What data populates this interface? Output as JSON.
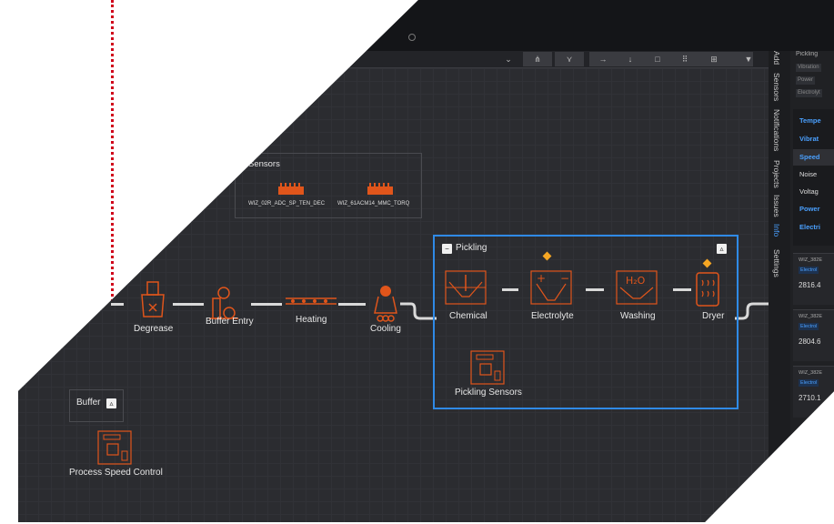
{
  "colors": {
    "accent": "#2f8ae6",
    "icon": "#e0551b",
    "warning": "#f5a623",
    "annotation": "#d0021b"
  },
  "toolbar": {
    "buttons": [
      "chevron-down-icon",
      "hierarchy-icon",
      "branch-icon",
      "arrow-right-icon",
      "arrow-down-icon",
      "frame-icon",
      "dots-icon",
      "grid-icon",
      "filter-icon"
    ]
  },
  "side_tabs": [
    "Add",
    "Sensors",
    "Notifications",
    "Projects",
    "Issues",
    "Info",
    "Settings"
  ],
  "side_tabs_active": "Info",
  "right_panel": {
    "title": "Pickling",
    "chips": [
      "Vibration",
      "Power",
      "Electrolyt"
    ],
    "metrics": [
      "Tempe",
      "Vibrat",
      "Speed",
      "Noise",
      "Voltag",
      "Power",
      "Electri"
    ],
    "cards": [
      {
        "id": "WIZ_382E",
        "tag": "Electrol",
        "value": "2816.4"
      },
      {
        "id": "WIZ_382E",
        "tag": "Electrol",
        "value": "2804.6"
      },
      {
        "id": "WIZ_382E",
        "tag": "Electrol",
        "value": "2710.1"
      }
    ]
  },
  "sensors_group": {
    "title": "Sensors",
    "items": [
      "WIZ_02R_ADC_SP_TEN_DEC",
      "WIZ_61ACM14_MMC_TORQ"
    ]
  },
  "line": {
    "nodes": [
      "Degrease",
      "Buffer Entry",
      "Heating",
      "Cooling"
    ]
  },
  "pickling": {
    "title": "Pickling",
    "nodes": [
      "Chemical",
      "Electrolyte",
      "Washing",
      "Dryer"
    ],
    "sensors_label": "Pickling Sensors"
  },
  "buffer": {
    "title": "Buffer",
    "controller_label": "Process Speed Control"
  }
}
